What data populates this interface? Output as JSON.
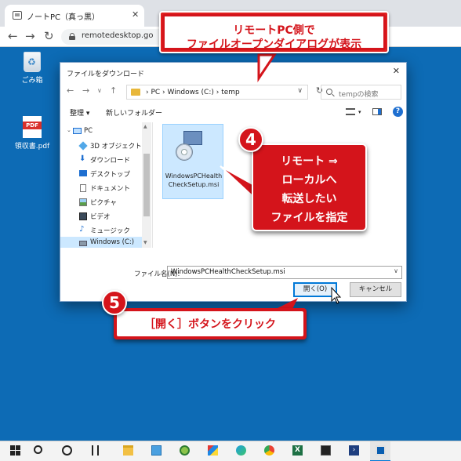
{
  "browser": {
    "tab_title": "ノートPC（真っ黒）",
    "url": "remotedesktop.go"
  },
  "desktop": {
    "icons": [
      {
        "label": "ごみ箱",
        "icon": "recycle-bin-icon"
      },
      {
        "label": "領収書.pdf",
        "icon": "pdf-file-icon",
        "badge": "PDF"
      }
    ]
  },
  "dialog": {
    "title": "ファイルをダウンロード",
    "address": "›  PC  ›  Windows (C:)  ›  temp",
    "search_placeholder": "tempの検索",
    "organize_label": "整理 ▾",
    "new_folder_label": "新しいフォルダー",
    "nav_items": [
      {
        "label": "PC",
        "icon": "pc-icon"
      },
      {
        "label": "3D オブジェクト",
        "icon": "3d-objects-icon"
      },
      {
        "label": "ダウンロード",
        "icon": "download-icon"
      },
      {
        "label": "デスクトップ",
        "icon": "desktop-icon"
      },
      {
        "label": "ドキュメント",
        "icon": "documents-icon"
      },
      {
        "label": "ピクチャ",
        "icon": "pictures-icon"
      },
      {
        "label": "ビデオ",
        "icon": "videos-icon"
      },
      {
        "label": "ミュージック",
        "icon": "music-icon"
      },
      {
        "label": "Windows (C:)",
        "icon": "drive-icon"
      }
    ],
    "file_name": "WindowsPCHealthCheckSetup.msi",
    "filename_label": "ファイル名(N):",
    "filename_value": "WindowsPCHealthCheckSetup.msi",
    "open_label": "開く(O)",
    "cancel_label": "キャンセル"
  },
  "annotations": {
    "top_line1": "リモートPC側で",
    "top_line2": "ファイルオープンダイアログが表示",
    "step4_number": "4",
    "step4_lines": [
      "リモート ⇒",
      "ローカルへ",
      "転送したい",
      "ファイルを指定"
    ],
    "step5_number": "5",
    "step5_text": "［開く］ボタンをクリック"
  },
  "taskbar": {
    "icons": [
      "start-icon",
      "search-icon",
      "cortana-icon",
      "task-view-icon",
      "file-explorer-icon",
      "photos-icon",
      "maps-icon",
      "paint-icon",
      "edge-icon",
      "chrome-icon",
      "excel-icon",
      "terminal-icon",
      "powershell-icon",
      "remote-desktop-icon"
    ]
  },
  "colors": {
    "desktop_bg": "#0d6bb5",
    "annotation_red": "#d4141b",
    "selection_blue": "#cce8ff"
  }
}
